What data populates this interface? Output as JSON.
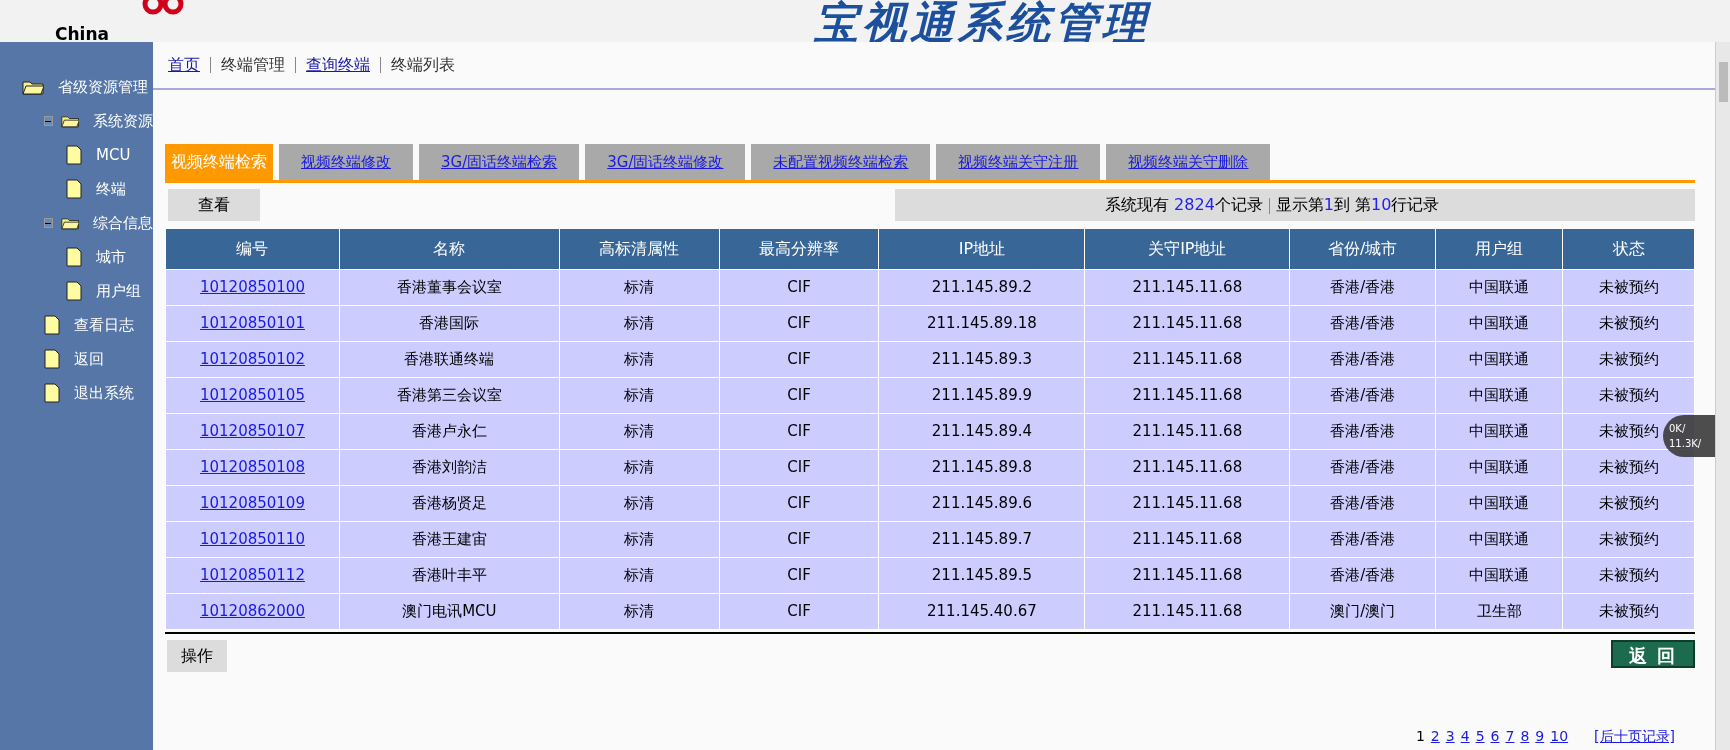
{
  "header": {
    "logo_text": "China",
    "title": "宝视通系统管理"
  },
  "sidebar": {
    "items": [
      {
        "label": "省级资源管理",
        "kind": "folder",
        "children": [
          {
            "label": "系统资源",
            "kind": "folder",
            "expanded": true,
            "children": [
              {
                "label": "MCU",
                "kind": "page"
              },
              {
                "label": "终端",
                "kind": "page"
              }
            ]
          },
          {
            "label": "综合信息",
            "kind": "folder",
            "expanded": true,
            "children": [
              {
                "label": "城市",
                "kind": "page"
              },
              {
                "label": "用户组",
                "kind": "page"
              }
            ]
          },
          {
            "label": "查看日志",
            "kind": "page"
          },
          {
            "label": "返回",
            "kind": "page"
          },
          {
            "label": "退出系统",
            "kind": "page"
          }
        ]
      }
    ]
  },
  "breadcrumb": [
    {
      "label": "首页",
      "link": true
    },
    {
      "label": "终端管理",
      "link": false
    },
    {
      "label": "查询终端",
      "link": true
    },
    {
      "label": "终端列表",
      "link": false
    }
  ],
  "tabs": [
    {
      "label": "视频终端检索",
      "selected": true
    },
    {
      "label": "视频终端修改",
      "selected": false
    },
    {
      "label": "3G/固话终端检索",
      "selected": false
    },
    {
      "label": "3G/固话终端修改",
      "selected": false
    },
    {
      "label": "未配置视频终端检索",
      "selected": false
    },
    {
      "label": "视频终端关守注册",
      "selected": false
    },
    {
      "label": "视频终端关守删除",
      "selected": false
    }
  ],
  "view_button": "查看",
  "summary": {
    "prefix": "系统现有",
    "total": "2824",
    "total_suffix": "个记录",
    "range_prefix": "显示第",
    "from": "1",
    "range_mid": "到",
    "range_prefix2": "第",
    "to": "10",
    "range_suffix": "行记录"
  },
  "table": {
    "columns": [
      "编号",
      "名称",
      "高标清属性",
      "最高分辨率",
      "IP地址",
      "关守IP地址",
      "省份/城市",
      "用户组",
      "状态"
    ],
    "rows": [
      [
        "10120850100",
        "香港董事会议室",
        "标清",
        "CIF",
        "211.145.89.2",
        "211.145.11.68",
        "香港/香港",
        "中国联通",
        "未被预约"
      ],
      [
        "10120850101",
        "香港国际",
        "标清",
        "CIF",
        "211.145.89.18",
        "211.145.11.68",
        "香港/香港",
        "中国联通",
        "未被预约"
      ],
      [
        "10120850102",
        "香港联通终端",
        "标清",
        "CIF",
        "211.145.89.3",
        "211.145.11.68",
        "香港/香港",
        "中国联通",
        "未被预约"
      ],
      [
        "10120850105",
        "香港第三会议室",
        "标清",
        "CIF",
        "211.145.89.9",
        "211.145.11.68",
        "香港/香港",
        "中国联通",
        "未被预约"
      ],
      [
        "10120850107",
        "香港卢永仁",
        "标清",
        "CIF",
        "211.145.89.4",
        "211.145.11.68",
        "香港/香港",
        "中国联通",
        "未被预约"
      ],
      [
        "10120850108",
        "香港刘韵洁",
        "标清",
        "CIF",
        "211.145.89.8",
        "211.145.11.68",
        "香港/香港",
        "中国联通",
        "未被预约"
      ],
      [
        "10120850109",
        "香港杨贤足",
        "标清",
        "CIF",
        "211.145.89.6",
        "211.145.11.68",
        "香港/香港",
        "中国联通",
        "未被预约"
      ],
      [
        "10120850110",
        "香港王建宙",
        "标清",
        "CIF",
        "211.145.89.7",
        "211.145.11.68",
        "香港/香港",
        "中国联通",
        "未被预约"
      ],
      [
        "10120850112",
        "香港叶丰平",
        "标清",
        "CIF",
        "211.145.89.5",
        "211.145.11.68",
        "香港/香港",
        "中国联通",
        "未被预约"
      ],
      [
        "10120862000",
        "澳门电讯MCU",
        "标清",
        "CIF",
        "211.145.40.67",
        "211.145.11.68",
        "澳门/澳门",
        "卫生部",
        "未被预约"
      ]
    ]
  },
  "action_button": "操作",
  "back_button": "返 回",
  "pager": {
    "pages": [
      "1",
      "2",
      "3",
      "4",
      "5",
      "6",
      "7",
      "8",
      "9",
      "10"
    ],
    "next": "[后十页记录]"
  },
  "speed_widget": {
    "upload": "0K/",
    "download": "11.3K/"
  }
}
